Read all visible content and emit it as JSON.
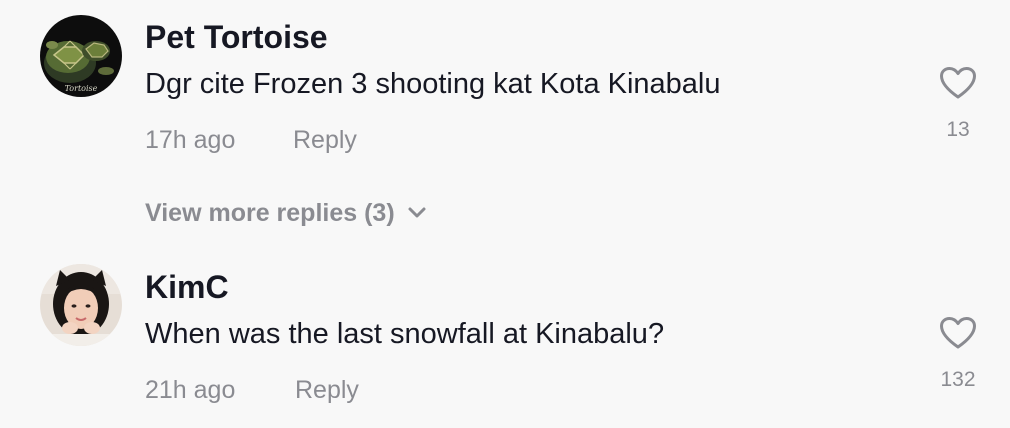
{
  "comments": [
    {
      "username": "Pet Tortoise",
      "text": "Dgr cite Frozen 3 shooting kat Kota Kinabalu",
      "time": "17h ago",
      "reply_label": "Reply",
      "likes": "13",
      "avatar": "tortoise-avatar"
    },
    {
      "username": "KimC",
      "text": "When was the last snowfall at Kinabalu?",
      "time": "21h ago",
      "reply_label": "Reply",
      "likes": "132",
      "avatar": "user-photo-avatar"
    }
  ],
  "view_more": {
    "label": "View more replies (3)",
    "icon": "chevron-down-icon"
  },
  "colors": {
    "background": "#f8f8f8",
    "username": "#161823",
    "text": "#161823",
    "muted": "#8a8b91"
  }
}
